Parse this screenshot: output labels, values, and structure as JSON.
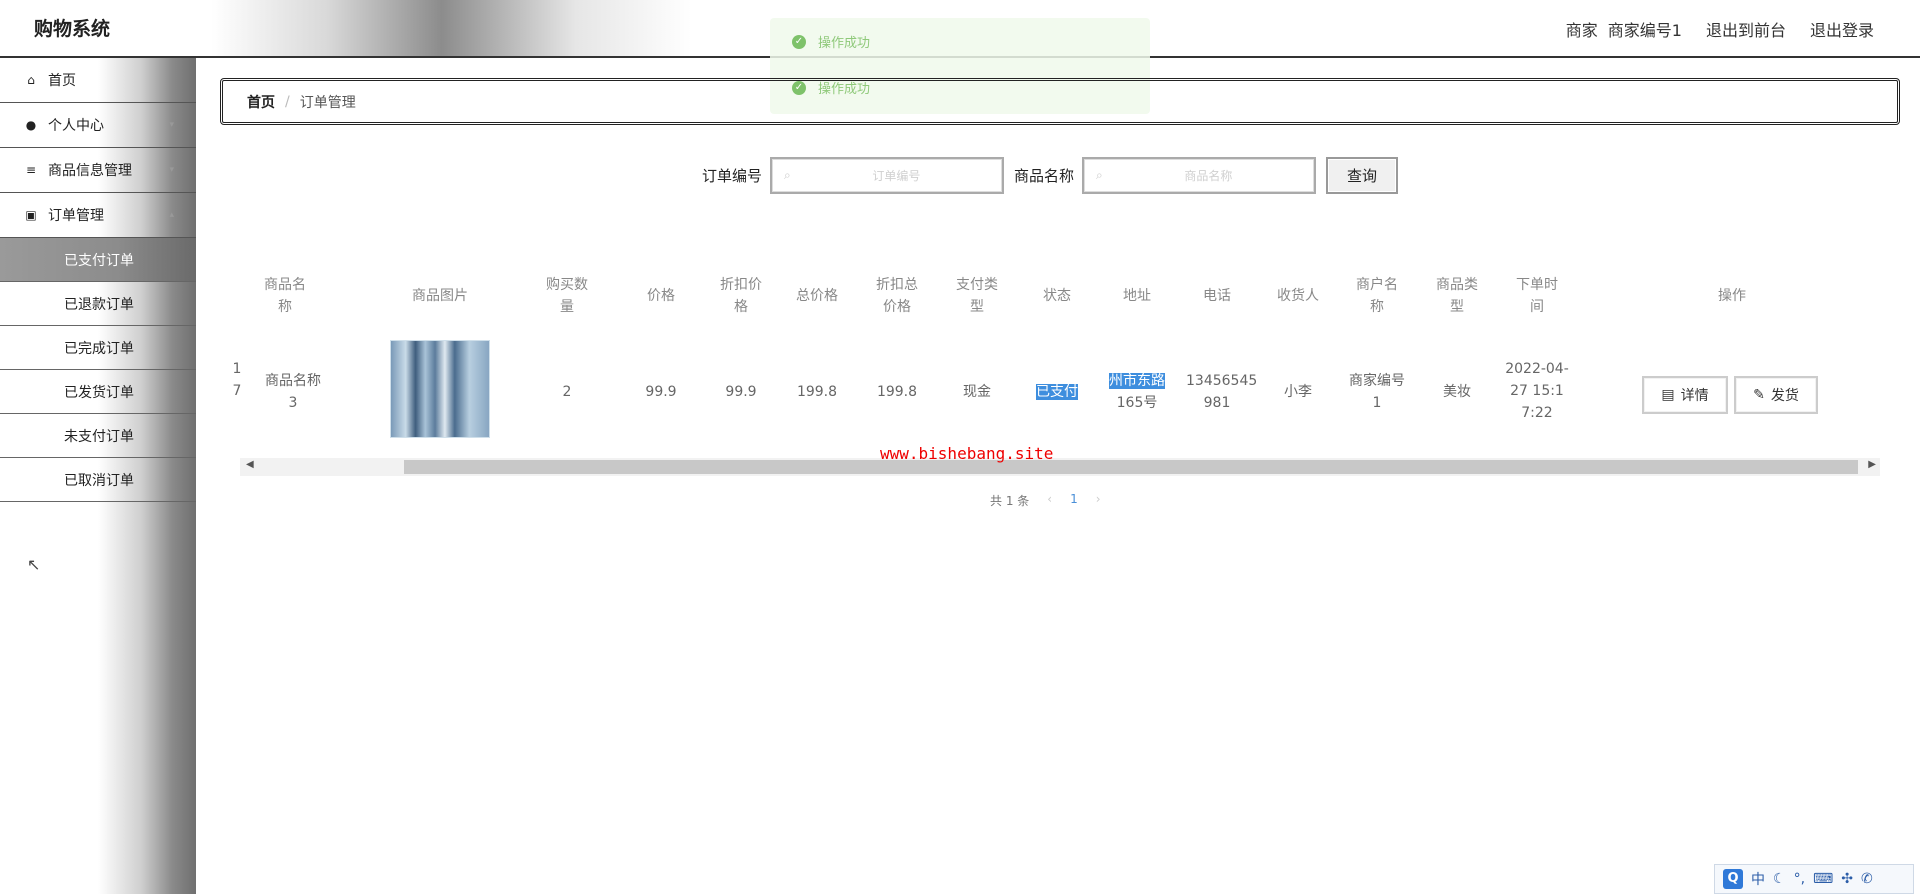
{
  "header": {
    "app_title": "购物系统",
    "role_label": "商家",
    "user_name": "商家编号1",
    "exit_front": "退出到前台",
    "logout": "退出登录"
  },
  "toast": {
    "messages": [
      "操作成功",
      "操作成功"
    ],
    "icon": "check-circle-icon"
  },
  "sidebar": {
    "items": [
      {
        "label": "首页",
        "icon": "home-icon"
      },
      {
        "label": "个人中心",
        "icon": "user-icon"
      },
      {
        "label": "商品信息管理",
        "icon": "list-icon"
      },
      {
        "label": "订单管理",
        "icon": "clipboard-icon"
      }
    ],
    "order_sub": [
      "已支付订单",
      "已退款订单",
      "已完成订单",
      "已发货订单",
      "未支付订单",
      "已取消订单"
    ],
    "active_sub": "已支付订单"
  },
  "breadcrumb": {
    "home": "首页",
    "sep": "/",
    "current": "订单管理"
  },
  "search": {
    "order_no_label": "订单编号",
    "order_no_placeholder": "订单编号",
    "product_label": "商品名称",
    "product_placeholder": "商品名称",
    "query_button": "查询"
  },
  "table": {
    "headers": [
      "商品名\n称",
      "商品图片",
      "购买数\n量",
      "价格",
      "折扣价\n格",
      "总价格",
      "折扣总\n价格",
      "支付类\n型",
      "状态",
      "地址",
      "电话",
      "收货人",
      "商户名\n称",
      "商品类\n型",
      "下单时\n间",
      "操作"
    ],
    "row": {
      "index": "1\n7",
      "product_name": "商品名称\n3",
      "quantity": "2",
      "price": "99.9",
      "discount_price": "99.9",
      "total": "199.8",
      "discount_total": "199.8",
      "pay_type": "现金",
      "status": "已支付",
      "address_line1": "州市东路",
      "address_line2": "165号",
      "phone": "13456545\n981",
      "receiver": "小李",
      "merchant": "商家编号\n1",
      "category": "美妆",
      "order_time": "2022-04-\n27 15:1\n7:22",
      "detail_button": "详情",
      "ship_button": "发货"
    }
  },
  "watermark": "www.bishebang.site",
  "pagination": {
    "total_text": "共 1 条",
    "prev": "‹",
    "page": "1",
    "next": "›"
  },
  "ime": {
    "logo": "Q",
    "mode": "中"
  }
}
